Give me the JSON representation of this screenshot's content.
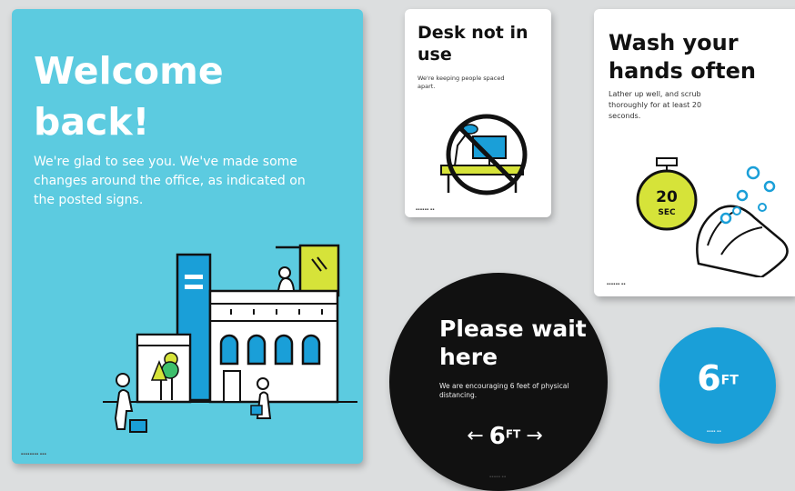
{
  "colors": {
    "poster_bg": "#5ccbe0",
    "accent_yellow": "#d6e339",
    "accent_blue": "#1a9fd8",
    "black": "#111111"
  },
  "welcome": {
    "title": "Welcome back!",
    "body": "We're glad to see you. We've made some changes around the office, as indicated on the posted signs."
  },
  "desk": {
    "title": "Desk not in use",
    "subtitle": "We're keeping people spaced apart."
  },
  "wash": {
    "title": "Wash your hands often",
    "subtitle": "Lather up well, and scrub thoroughly for at least 20 seconds.",
    "timer_number": "20",
    "timer_unit": "SEC"
  },
  "wait": {
    "title": "Please wait here",
    "subtitle": "We are encouraging 6 feet of physical distancing.",
    "arrow_left": "←",
    "arrow_right": "→",
    "distance": "6",
    "unit": "FT"
  },
  "six": {
    "distance": "6",
    "unit": "FT"
  }
}
